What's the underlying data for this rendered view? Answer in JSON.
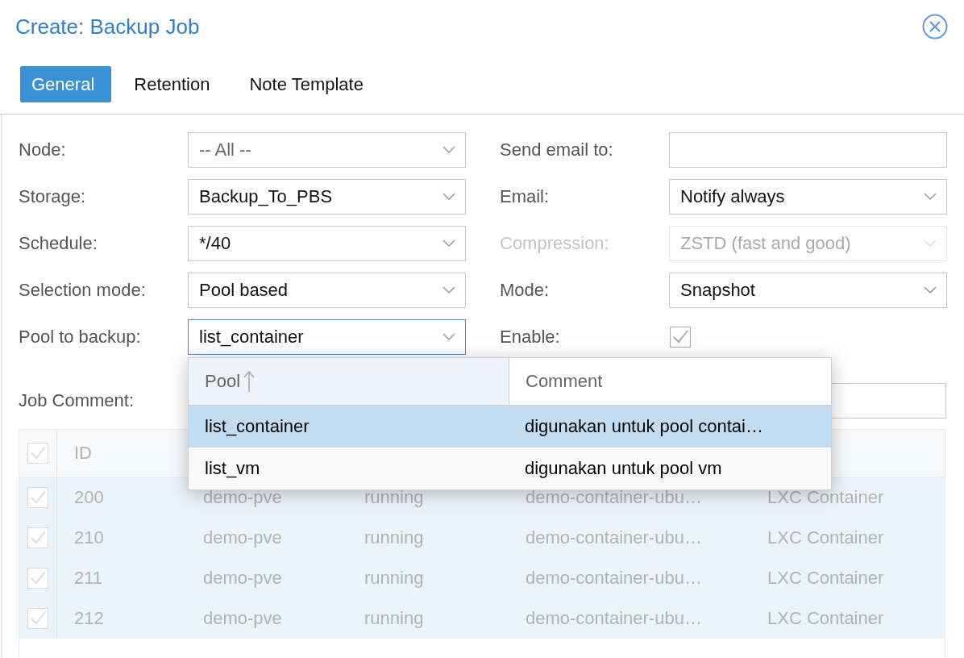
{
  "dialog": {
    "title": "Create: Backup Job"
  },
  "tabs": [
    {
      "label": "General",
      "selected": true
    },
    {
      "label": "Retention",
      "selected": false
    },
    {
      "label": "Note Template",
      "selected": false
    }
  ],
  "form": {
    "left": [
      {
        "label": "Node:",
        "kind": "combo",
        "value": "-- All --",
        "placeholder_style": true,
        "disabled": false,
        "focused": false
      },
      {
        "label": "Storage:",
        "kind": "combo",
        "value": "Backup_To_PBS",
        "disabled": false,
        "focused": false
      },
      {
        "label": "Schedule:",
        "kind": "combo",
        "value": "*/40",
        "disabled": false,
        "focused": false
      },
      {
        "label": "Selection mode:",
        "kind": "combo",
        "value": "Pool based",
        "disabled": false,
        "focused": false
      },
      {
        "label": "Pool to backup:",
        "kind": "combo",
        "value": "list_container",
        "disabled": false,
        "focused": true
      }
    ],
    "right": [
      {
        "label": "Send email to:",
        "kind": "text",
        "disabled": false,
        "focused": false
      },
      {
        "label": "Email:",
        "kind": "combo",
        "value": "Notify always",
        "disabled": false,
        "focused": false
      },
      {
        "label": "Compression:",
        "kind": "combo",
        "value": "ZSTD (fast and good)",
        "disabled": true,
        "focused": false
      },
      {
        "label": "Mode:",
        "kind": "combo",
        "value": "Snapshot",
        "disabled": false,
        "focused": false
      },
      {
        "label": "Enable:",
        "kind": "checkbox",
        "checked": true,
        "disabled": false
      }
    ]
  },
  "job_comment": {
    "label": "Job Comment:"
  },
  "grid": {
    "disabled": true,
    "all_checked": true,
    "columns": [
      "ID"
    ],
    "rows": [
      {
        "checked": true,
        "selected": true,
        "cells": [
          "200",
          "demo-pve",
          "running",
          "demo-container-ubu…",
          "LXC Container"
        ]
      },
      {
        "checked": true,
        "selected": true,
        "cells": [
          "210",
          "demo-pve",
          "running",
          "demo-container-ubu…",
          "LXC Container"
        ]
      },
      {
        "checked": true,
        "selected": true,
        "cells": [
          "211",
          "demo-pve",
          "running",
          "demo-container-ubu…",
          "LXC Container"
        ]
      },
      {
        "checked": true,
        "selected": true,
        "cells": [
          "212",
          "demo-pve",
          "running",
          "demo-container-ubu…",
          "LXC Container"
        ]
      }
    ]
  },
  "dropdown": {
    "columns": [
      {
        "label": "Pool",
        "sorted": true
      },
      {
        "label": "Comment",
        "sorted": false
      }
    ],
    "rows": [
      {
        "selected": true,
        "cells": [
          "list_container",
          "digunakan untuk pool contai…"
        ]
      },
      {
        "selected": false,
        "cells": [
          "list_vm",
          "digunakan untuk pool vm"
        ]
      }
    ]
  }
}
